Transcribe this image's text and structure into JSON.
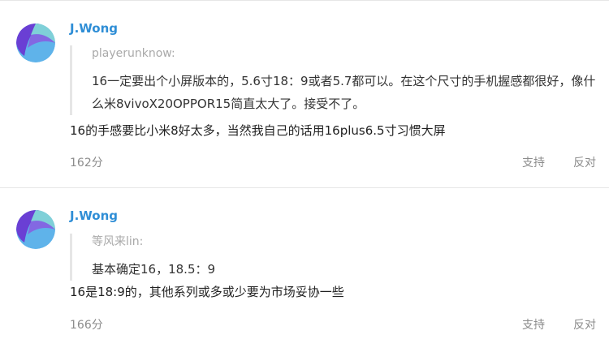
{
  "comments": [
    {
      "username": "J.Wong",
      "quote": {
        "author": "playerunknow:",
        "text": "16一定要出个小屏版本的，5.6寸18：9或者5.7都可以。在这个尺寸的手机握感都很好，像什么米8vivoX20OPPOR15简直太大了。接受不了。"
      },
      "reply": "16的手感要比小米8好太多，当然我自己的话用16plus6.5寸习惯大屏",
      "score": "162分",
      "support_label": "支持",
      "oppose_label": "反对"
    },
    {
      "username": "J.Wong",
      "quote": {
        "author": "等风来lin:",
        "text": "基本确定16，18.5：9"
      },
      "reply": "16是18:9的，其他系列或多或少要为市场妥协一些",
      "score": "166分",
      "support_label": "支持",
      "oppose_label": "反对"
    }
  ],
  "colors": {
    "username": "#2f8ed6",
    "quote_author": "#a9a9a9",
    "meta": "#8c8c8c",
    "avatar_purple": "#6a3fd4",
    "avatar_blue": "#5fb3ea",
    "avatar_teal": "#7fd0d8"
  }
}
